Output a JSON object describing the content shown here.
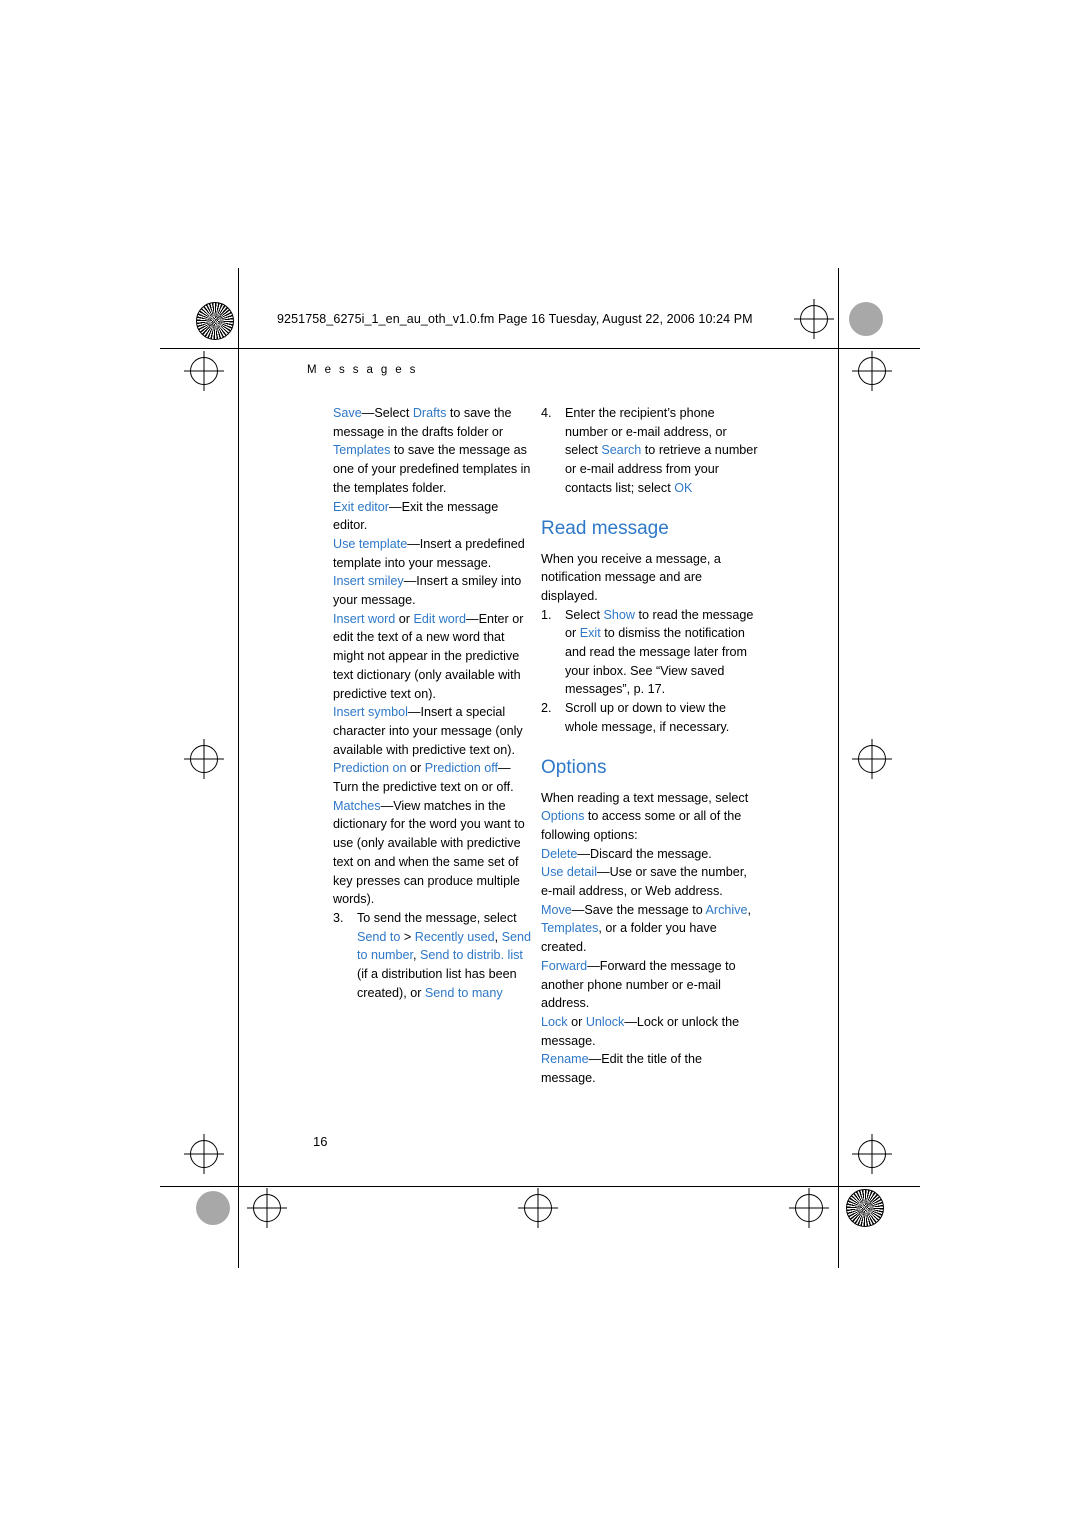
{
  "header": {
    "file_line": "9251758_6275i_1_en_au_oth_v1.0.fm  Page 16  Tuesday, August 22, 2006  10:24 PM",
    "running_head": "M e s s a g e s"
  },
  "page_number": "16",
  "colors": {
    "accent_blue": "#2e78c8",
    "text_black": "#000000",
    "registration_gray": "#a8a8a8"
  },
  "left_column": {
    "items": [
      {
        "id": "save-item",
        "parts": [
          {
            "text": "Save",
            "style": "blue"
          },
          {
            "text": "—Select ",
            "style": "plain"
          },
          {
            "text": "Drafts",
            "style": "blue"
          },
          {
            "text": " to save the message in the drafts folder or ",
            "style": "plain"
          },
          {
            "text": "Templates",
            "style": "blue"
          },
          {
            "text": " to save the message as one of your predefined templates in the templates folder.",
            "style": "plain"
          }
        ]
      },
      {
        "id": "exit-editor-item",
        "parts": [
          {
            "text": "Exit editor",
            "style": "blue"
          },
          {
            "text": "—Exit the message editor.",
            "style": "plain"
          }
        ]
      },
      {
        "id": "use-template-item",
        "parts": [
          {
            "text": "Use template",
            "style": "blue"
          },
          {
            "text": "—Insert a predefined template into your message.",
            "style": "plain"
          }
        ]
      },
      {
        "id": "insert-smiley-item",
        "parts": [
          {
            "text": "Insert smiley",
            "style": "blue"
          },
          {
            "text": "—Insert a smiley into your message.",
            "style": "plain"
          }
        ]
      },
      {
        "id": "insert-word-item",
        "parts": [
          {
            "text": "Insert word",
            "style": "blue"
          },
          {
            "text": " or ",
            "style": "plain"
          },
          {
            "text": "Edit word",
            "style": "blue"
          },
          {
            "text": "—Enter or edit the text of a new word that might not appear in the predictive text dictionary (only available with predictive text on).",
            "style": "plain"
          }
        ]
      },
      {
        "id": "insert-symbol-item",
        "parts": [
          {
            "text": "Insert symbol",
            "style": "blue"
          },
          {
            "text": "—Insert a special character into your message (only available with predictive text on).",
            "style": "plain"
          }
        ]
      },
      {
        "id": "prediction-item",
        "parts": [
          {
            "text": "Prediction on",
            "style": "blue"
          },
          {
            "text": " or ",
            "style": "plain"
          },
          {
            "text": "Prediction off",
            "style": "blue"
          },
          {
            "text": "—Turn the predictive text on or off.",
            "style": "plain"
          }
        ]
      },
      {
        "id": "matches-item",
        "parts": [
          {
            "text": "Matches",
            "style": "blue"
          },
          {
            "text": "—View matches in the dictionary for the word you want to use (only available with predictive text on and when the same set of key presses can produce multiple words).",
            "style": "plain"
          }
        ]
      }
    ],
    "step3": {
      "number": "3.",
      "parts": [
        {
          "text": "To send the message, select ",
          "style": "plain"
        },
        {
          "text": "Send to",
          "style": "blue"
        },
        {
          "text": " > ",
          "style": "plain"
        },
        {
          "text": "Recently used",
          "style": "blue"
        },
        {
          "text": ", ",
          "style": "plain"
        },
        {
          "text": "Send to number",
          "style": "blue"
        },
        {
          "text": ", ",
          "style": "plain"
        },
        {
          "text": "Send to distrib. list",
          "style": "blue"
        },
        {
          "text": " (if a distribution list has been created), or ",
          "style": "plain"
        },
        {
          "text": "Send to many",
          "style": "blue"
        }
      ]
    }
  },
  "right_column": {
    "step4": {
      "number": "4.",
      "parts": [
        {
          "text": "Enter the recipient’s phone number or e-mail address, or select ",
          "style": "plain"
        },
        {
          "text": "Search",
          "style": "blue"
        },
        {
          "text": " to retrieve a number or e-mail address from your contacts list; select ",
          "style": "plain"
        },
        {
          "text": "OK",
          "style": "blue"
        }
      ]
    },
    "read_message": {
      "heading": "Read message",
      "intro": "When you receive a message, a notification message and         are displayed.",
      "steps": [
        {
          "number": "1.",
          "parts": [
            {
              "text": "Select ",
              "style": "plain"
            },
            {
              "text": "Show",
              "style": "blue"
            },
            {
              "text": " to read the message or ",
              "style": "plain"
            },
            {
              "text": "Exit",
              "style": "blue"
            },
            {
              "text": " to dismiss the notification and read the message later from your inbox. See “View saved messages”, p. 17.",
              "style": "plain"
            }
          ]
        },
        {
          "number": "2.",
          "parts": [
            {
              "text": "Scroll up or down to view the whole message, if necessary.",
              "style": "plain"
            }
          ]
        }
      ]
    },
    "options": {
      "heading": "Options",
      "intro_parts": [
        {
          "text": "When reading a text message, select ",
          "style": "plain"
        },
        {
          "text": "Options",
          "style": "blue"
        },
        {
          "text": " to access some or all of the following options:",
          "style": "plain"
        }
      ],
      "items": [
        {
          "id": "delete-item",
          "parts": [
            {
              "text": "Delete",
              "style": "blue"
            },
            {
              "text": "—Discard the message.",
              "style": "plain"
            }
          ]
        },
        {
          "id": "use-detail-item",
          "parts": [
            {
              "text": "Use detail",
              "style": "blue"
            },
            {
              "text": "—Use or save the number, e-mail address, or Web address.",
              "style": "plain"
            }
          ]
        },
        {
          "id": "move-item",
          "parts": [
            {
              "text": "Move",
              "style": "blue"
            },
            {
              "text": "—Save the message to ",
              "style": "plain"
            },
            {
              "text": "Archive",
              "style": "blue"
            },
            {
              "text": ", ",
              "style": "plain"
            },
            {
              "text": "Templates",
              "style": "blue"
            },
            {
              "text": ", or a folder you have created.",
              "style": "plain"
            }
          ]
        },
        {
          "id": "forward-item",
          "parts": [
            {
              "text": "Forward",
              "style": "blue"
            },
            {
              "text": "—Forward the message to another phone number or e-mail address.",
              "style": "plain"
            }
          ]
        },
        {
          "id": "lock-item",
          "parts": [
            {
              "text": "Lock",
              "style": "blue"
            },
            {
              "text": " or ",
              "style": "plain"
            },
            {
              "text": "Unlock",
              "style": "blue"
            },
            {
              "text": "—Lock or unlock the message.",
              "style": "plain"
            }
          ]
        },
        {
          "id": "rename-item",
          "parts": [
            {
              "text": "Rename",
              "style": "blue"
            },
            {
              "text": "—Edit the title of the message.",
              "style": "plain"
            }
          ]
        }
      ]
    }
  }
}
